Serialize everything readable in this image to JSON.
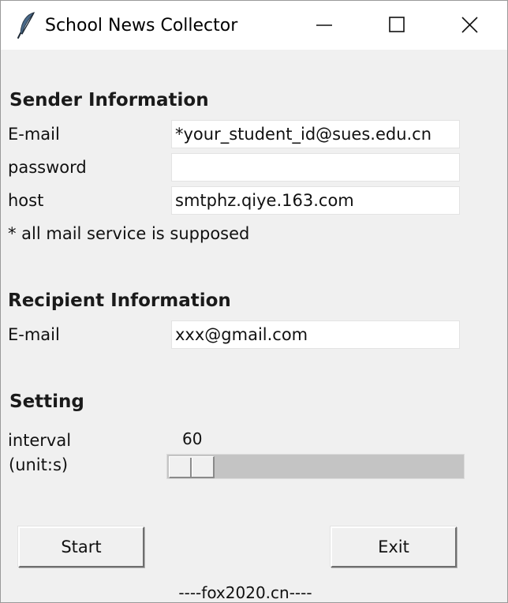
{
  "window": {
    "title": "School News Collector",
    "icon": "feather-icon",
    "controls": [
      "minimize-icon",
      "maximize-icon",
      "close-icon"
    ]
  },
  "sender": {
    "heading": "Sender Information",
    "email_label": "E-mail",
    "email_value": "*your_student_id@sues.edu.cn",
    "password_label": "password",
    "password_value": "",
    "host_label": "host",
    "host_value": "smtphz.qiye.163.com",
    "note": "* all mail service is supposed"
  },
  "recipient": {
    "heading": "Recipient Information",
    "email_label": "E-mail",
    "email_value": "xxx@gmail.com"
  },
  "setting": {
    "heading": "Setting",
    "interval_label": "interval",
    "unit_label": "(unit:s)",
    "interval_value": "60",
    "slider_min": 60,
    "slider_max": 600,
    "slider_fraction": 0
  },
  "buttons": {
    "start_label": "Start",
    "exit_label": "Exit"
  },
  "footer": {
    "text": "----fox2020.cn----"
  },
  "colors": {
    "window_bg": "#f0f0f0",
    "titlebar_bg": "#ffffff",
    "slider_trough": "#c4c4c4",
    "icon_blue": "#1e63b4"
  }
}
